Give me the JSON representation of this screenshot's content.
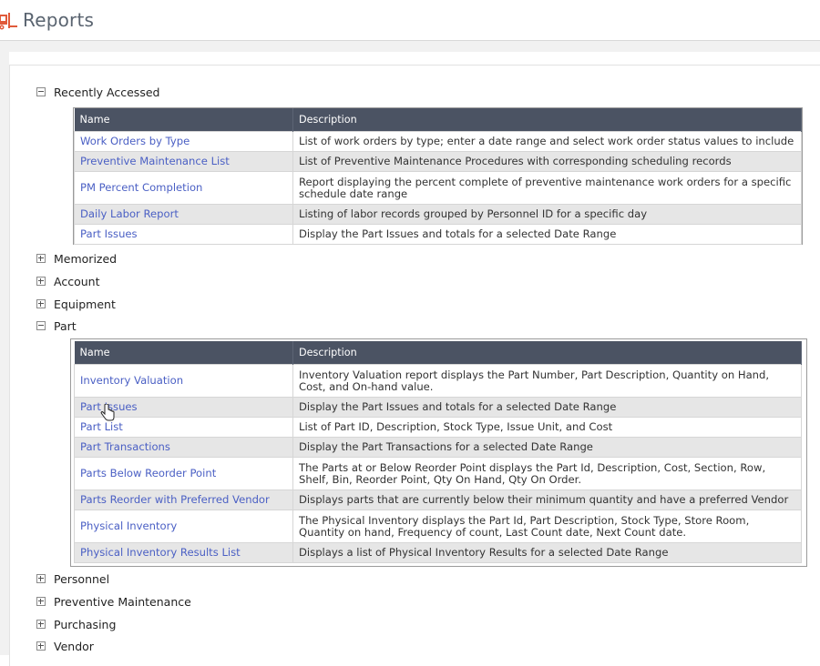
{
  "header": {
    "title": "Reports",
    "logo_icon": "forklift-icon",
    "accent": "#e05a3a"
  },
  "sections": [
    {
      "label": "Recently Accessed",
      "expanded": true
    },
    {
      "label": "Memorized",
      "expanded": false
    },
    {
      "label": "Account",
      "expanded": false
    },
    {
      "label": "Equipment",
      "expanded": false
    },
    {
      "label": "Part",
      "expanded": true
    },
    {
      "label": "Personnel",
      "expanded": false
    },
    {
      "label": "Preventive Maintenance",
      "expanded": false
    },
    {
      "label": "Purchasing",
      "expanded": false
    },
    {
      "label": "Vendor",
      "expanded": false
    }
  ],
  "table_headers": {
    "name": "Name",
    "description": "Description"
  },
  "recently_accessed": [
    {
      "name": "Work Orders by Type",
      "description": "List of work orders by type; enter a date range and select work order status values to include"
    },
    {
      "name": "Preventive Maintenance List",
      "description": "List of Preventive Maintenance Procedures with corresponding scheduling records"
    },
    {
      "name": "PM Percent Completion",
      "description": "Report displaying the percent complete of preventive maintenance work orders for a specific schedule date range"
    },
    {
      "name": "Daily Labor Report",
      "description": "Listing of labor records grouped by Personnel ID for a specific day"
    },
    {
      "name": "Part Issues",
      "description": "Display the Part Issues and totals for a selected Date Range"
    }
  ],
  "part_reports": [
    {
      "name": "Inventory Valuation",
      "description": "Inventory Valuation report displays the Part Number, Part Description, Quantity on Hand, Cost, and On-hand value."
    },
    {
      "name": "Part Issues",
      "description": "Display the Part Issues and totals for a selected Date Range"
    },
    {
      "name": "Part List",
      "description": "List of Part ID, Description, Stock Type, Issue Unit, and Cost"
    },
    {
      "name": "Part Transactions",
      "description": "Display the Part Transactions for a selected Date Range"
    },
    {
      "name": "Parts Below Reorder Point",
      "description": "The Parts at or Below Reorder Point displays the Part Id, Description, Cost, Section, Row, Shelf, Bin, Reorder Point, Qty On Hand, Qty On Order."
    },
    {
      "name": "Parts Reorder with Preferred Vendor",
      "description": "Displays parts that are currently below their minimum quantity and have a preferred Vendor"
    },
    {
      "name": "Physical Inventory",
      "description": "The Physical Inventory displays the Part Id, Part Description, Stock Type, Store Room, Quantity on hand, Frequency of count, Last Count date, Next Count date."
    },
    {
      "name": "Physical Inventory Results List",
      "description": "Displays a list of Physical Inventory Results for a selected Date Range"
    }
  ]
}
